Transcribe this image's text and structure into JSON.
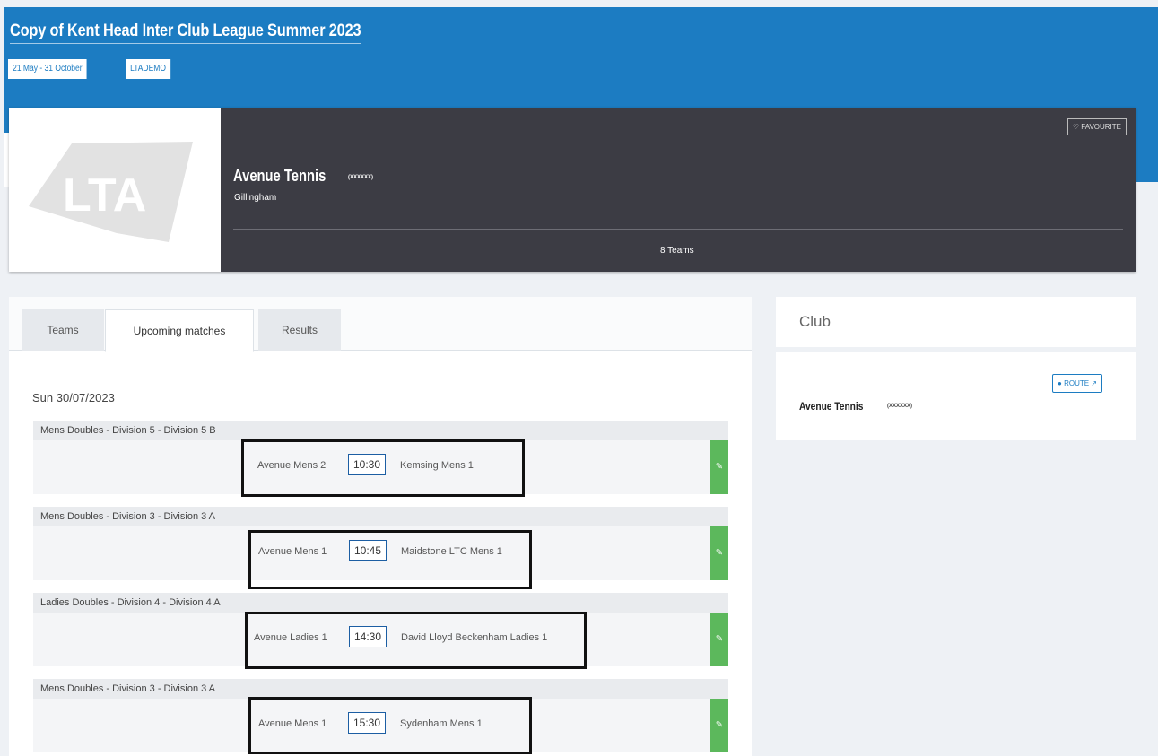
{
  "header": {
    "title": "Copy of Kent Head Inter Club League Summer 2023",
    "date_range": "21 May - 31 October",
    "code": "LTADEMO"
  },
  "club": {
    "logo_text": "LTA",
    "name": "Avenue Tennis",
    "code": "(XXXXXX)",
    "town": "Gillingham",
    "teams": "8 Teams",
    "favourite": "FAVOURITE"
  },
  "tabs": [
    {
      "label": "Teams"
    },
    {
      "label": "Upcoming matches"
    },
    {
      "label": "Results"
    }
  ],
  "date": "Sun 30/07/2023",
  "matches": [
    {
      "division": "Mens Doubles - Division 5 - Division 5 B",
      "home": "Avenue Mens 2",
      "time": "10:30",
      "away": "Kemsing Mens 1"
    },
    {
      "division": "Mens Doubles - Division 3 - Division 3 A",
      "home": "Avenue Mens 1",
      "time": "10:45",
      "away": "Maidstone LTC Mens 1"
    },
    {
      "division": "Ladies Doubles - Division 4 - Division 4 A",
      "home": "Avenue Ladies 1",
      "time": "14:30",
      "away": "David Lloyd Beckenham Ladies 1"
    },
    {
      "division": "Mens Doubles - Division 3 - Division 3 A",
      "home": "Avenue Mens 1",
      "time": "15:30",
      "away": "Sydenham Mens 1"
    }
  ],
  "sidebar": {
    "heading": "Club",
    "club_name": "Avenue Tennis",
    "club_code": "(XXXXXX)",
    "route": "ROUTE"
  }
}
